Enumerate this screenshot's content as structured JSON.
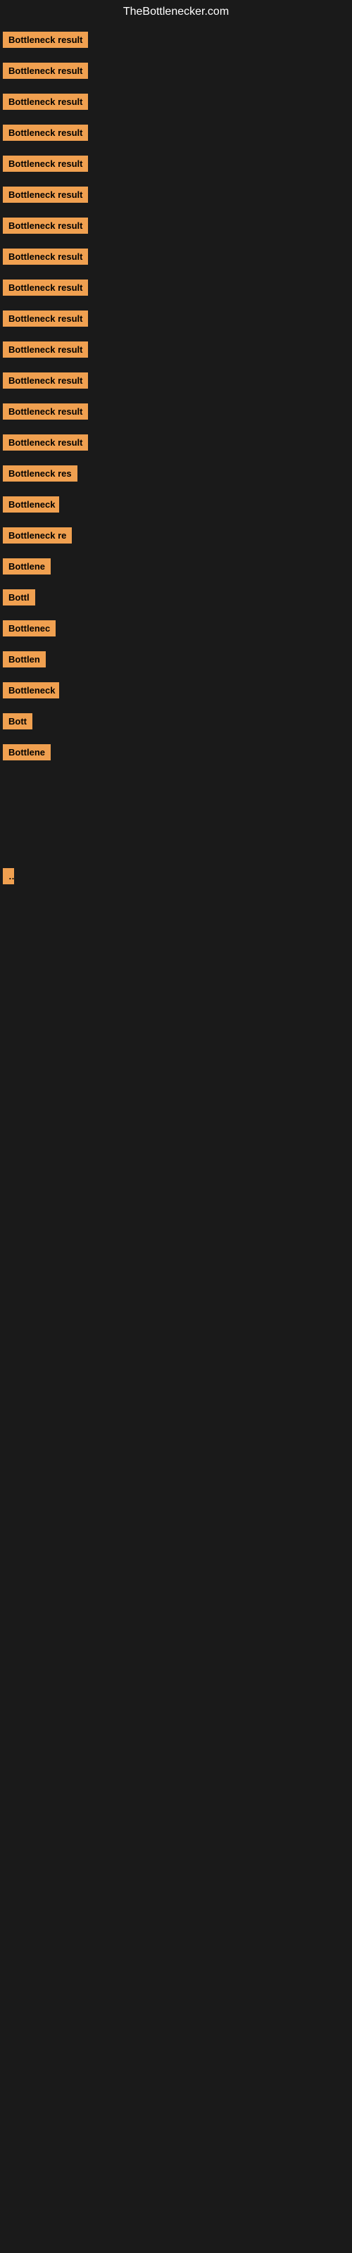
{
  "site": {
    "title": "TheBottlenecker.com"
  },
  "rows": [
    {
      "id": 1,
      "label": "Bottleneck result",
      "width": 130,
      "visible": true
    },
    {
      "id": 2,
      "label": "Bottleneck result",
      "width": 130,
      "visible": true
    },
    {
      "id": 3,
      "label": "Bottleneck result",
      "width": 130,
      "visible": true
    },
    {
      "id": 4,
      "label": "Bottleneck result",
      "width": 130,
      "visible": true
    },
    {
      "id": 5,
      "label": "Bottleneck result",
      "width": 130,
      "visible": true
    },
    {
      "id": 6,
      "label": "Bottleneck result",
      "width": 130,
      "visible": true
    },
    {
      "id": 7,
      "label": "Bottleneck result",
      "width": 130,
      "visible": true
    },
    {
      "id": 8,
      "label": "Bottleneck result",
      "width": 130,
      "visible": true
    },
    {
      "id": 9,
      "label": "Bottleneck result",
      "width": 130,
      "visible": true
    },
    {
      "id": 10,
      "label": "Bottleneck result",
      "width": 130,
      "visible": true
    },
    {
      "id": 11,
      "label": "Bottleneck result",
      "width": 130,
      "visible": true
    },
    {
      "id": 12,
      "label": "Bottleneck result",
      "width": 130,
      "visible": true
    },
    {
      "id": 13,
      "label": "Bottleneck result",
      "width": 130,
      "visible": true
    },
    {
      "id": 14,
      "label": "Bottleneck result",
      "width": 130,
      "visible": true
    },
    {
      "id": 15,
      "label": "Bottleneck res",
      "width": 110,
      "visible": true
    },
    {
      "id": 16,
      "label": "Bottleneck",
      "width": 80,
      "visible": true
    },
    {
      "id": 17,
      "label": "Bottleneck re",
      "width": 100,
      "visible": true
    },
    {
      "id": 18,
      "label": "Bottlene",
      "width": 70,
      "visible": true
    },
    {
      "id": 19,
      "label": "Bottl",
      "width": 50,
      "visible": true
    },
    {
      "id": 20,
      "label": "Bottlenec",
      "width": 75,
      "visible": true
    },
    {
      "id": 21,
      "label": "Bottlen",
      "width": 65,
      "visible": true
    },
    {
      "id": 22,
      "label": "Bottleneck",
      "width": 80,
      "visible": true
    },
    {
      "id": 23,
      "label": "Bott",
      "width": 45,
      "visible": true
    },
    {
      "id": 24,
      "label": "Bottlene",
      "width": 70,
      "visible": true
    },
    {
      "id": 25,
      "label": "",
      "width": 0,
      "visible": false
    },
    {
      "id": 26,
      "label": "",
      "width": 0,
      "visible": false
    },
    {
      "id": 27,
      "label": "",
      "width": 0,
      "visible": false
    },
    {
      "id": 28,
      "label": "…",
      "width": 10,
      "visible": true
    },
    {
      "id": 29,
      "label": "",
      "width": 0,
      "visible": false
    },
    {
      "id": 30,
      "label": "",
      "width": 0,
      "visible": false
    },
    {
      "id": 31,
      "label": "",
      "width": 0,
      "visible": false
    }
  ]
}
